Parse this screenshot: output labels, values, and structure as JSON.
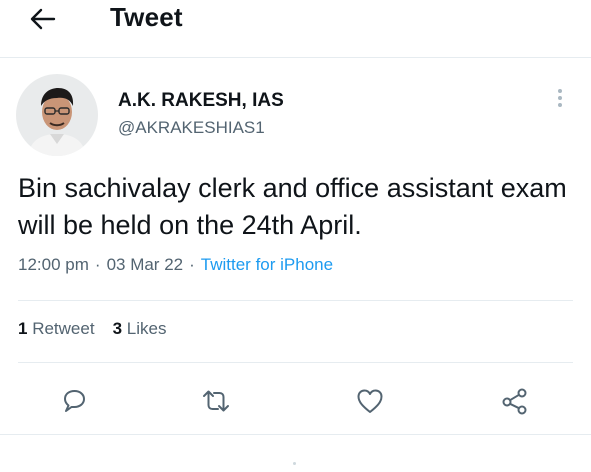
{
  "header": {
    "title": "Tweet",
    "back_icon": "arrow-left-icon"
  },
  "author": {
    "name": "A.K. RAKESH, IAS",
    "handle": "@AKRAKESHIAS1",
    "avatar_icon": "profile-photo"
  },
  "tweet": {
    "text": "Bin sachivalay clerk and office assistant exam will be held on the 24th April.",
    "time": "12:00 pm",
    "date": "03 Mar 22",
    "separator": "·",
    "source": "Twitter for iPhone"
  },
  "stats": {
    "retweets_count": "1",
    "retweets_label": "Retweet",
    "likes_count": "3",
    "likes_label": "Likes"
  },
  "actions": [
    "reply-icon",
    "retweet-icon",
    "like-icon",
    "share-icon"
  ],
  "colors": {
    "text": "#0f1419",
    "secondary": "#536471",
    "link": "#1d9bf0",
    "divider": "#e6ecf0"
  }
}
